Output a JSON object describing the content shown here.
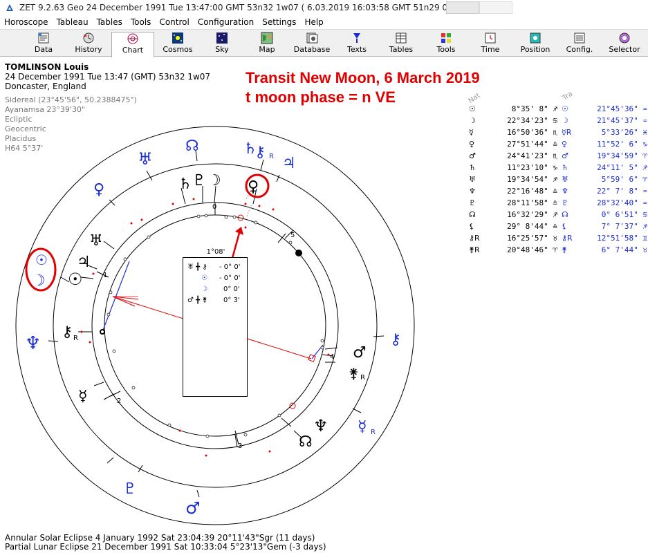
{
  "window": {
    "title": "ZET 9.2.63 Geo   24 December 1991  Tue  13:47:00 GMT 53n32  1w07   ( 6.03.2019  16:03:58 GMT 51n29 0w11)"
  },
  "menu": [
    "Horoscope",
    "Tableau",
    "Tables",
    "Tools",
    "Control",
    "Configuration",
    "Settings",
    "Help"
  ],
  "toolbar": [
    {
      "label": "Data",
      "icon": "data-icon"
    },
    {
      "label": "History",
      "icon": "history-icon"
    },
    {
      "label": "Chart",
      "icon": "chart-icon",
      "active": true
    },
    {
      "label": "Cosmos",
      "icon": "cosmos-icon"
    },
    {
      "label": "Sky",
      "icon": "sky-icon"
    },
    {
      "label": "Map",
      "icon": "map-icon"
    },
    {
      "label": "Database",
      "icon": "database-icon"
    },
    {
      "label": "Texts",
      "icon": "texts-icon"
    },
    {
      "label": "Tables",
      "icon": "tables-icon"
    },
    {
      "label": "Tools",
      "icon": "tools-icon"
    },
    {
      "label": "Time",
      "icon": "time-icon"
    },
    {
      "label": "Position",
      "icon": "position-icon"
    },
    {
      "label": "Config.",
      "icon": "config-icon"
    },
    {
      "label": "Selector",
      "icon": "selector-icon"
    }
  ],
  "person": {
    "name": "TOMLINSON Louis",
    "datetime": "24 December 1991  Tue  13:47 (GMT) 53n32  1w07",
    "place": "Doncaster, England"
  },
  "settings": [
    "Sidereal (23°45'56\", 50.2388475\")",
    "Ayanamsa 23°39'30\"",
    "Ecliptic",
    "Geocentric",
    "Placidus",
    "H64   5°37'"
  ],
  "overlay": {
    "line1": "Transit New Moon, 6 March 2019",
    "line2": "t moon phase = n VE"
  },
  "table_headers": {
    "natal": "Nat",
    "transit": "Tra"
  },
  "planets": [
    {
      "g1": "☉",
      "v1": "8°35' 8\" ♐",
      "g2": "☉",
      "v2": "21°45'36\" ♒"
    },
    {
      "g1": "☽",
      "v1": "22°34'23\" ♋",
      "g2": "☽",
      "v2": "21°45'37\" ♒"
    },
    {
      "g1": "☿",
      "v1": "16°50'36\" ♏",
      "g2": "☿R",
      "v2": "5°33'26\" ♓"
    },
    {
      "g1": "♀",
      "v1": "27°51'44\" ♎",
      "g2": "♀",
      "v2": "11°52' 6\" ♑"
    },
    {
      "g1": "♂",
      "v1": "24°41'23\" ♏",
      "g2": "♂",
      "v2": "19°34'59\" ♈"
    },
    {
      "g1": "♄",
      "v1": "11°23'10\" ♑",
      "g2": "♄",
      "v2": "24°11' 5\" ♐"
    },
    {
      "g1": "♅",
      "v1": "19°34'54\" ♐",
      "g2": "♅",
      "v2": "5°59' 6\" ♈"
    },
    {
      "g1": "♆",
      "v1": "22°16'48\" ♎",
      "g2": "♆",
      "v2": "22° 7' 8\" ♒"
    },
    {
      "g1": "♇",
      "v1": "28°11'58\" ♎",
      "g2": "♇",
      "v2": "28°32'40\" ♒"
    },
    {
      "g1": "☊",
      "v1": "16°32'29\" ♐",
      "g2": "☊",
      "v2": "0° 6'51\" ♋"
    },
    {
      "g1": "⚸",
      "v1": "29° 8'44\" ♎",
      "g2": "⚸",
      "v2": "7° 7'37\" ♐"
    },
    {
      "g1": "⚷R",
      "v1": "16°25'57\" ♉",
      "g2": "⚷R",
      "v2": "12°51'58\" ♊"
    },
    {
      "g1": "⚵R",
      "v1": "20°48'46\" ♈",
      "g2": "⚵",
      "v2": "6° 7'44\" ♉"
    }
  ],
  "aspect_box": {
    "header": "1°08'",
    "rows": [
      {
        "glyphs": "♅ ╋ ⚷",
        "value": "- 0° 0'"
      },
      {
        "glyphs": "☉",
        "value": "- 0° 0'"
      },
      {
        "glyphs": "☽",
        "value": "0° 0'"
      },
      {
        "glyphs": "♂ ╋ ⚵",
        "value": "0° 3'"
      }
    ]
  },
  "house_numbers": [
    "0",
    "1",
    "2",
    "3",
    "4",
    "5"
  ],
  "outer_glyphs": [
    "♅",
    "♀",
    "☊",
    "♄",
    "⚷",
    "♃",
    "♆",
    "⚷",
    "☿",
    "♆",
    "♂",
    "⚵",
    "♂",
    "♇"
  ],
  "inner_glyphs": [
    "♄",
    "♇",
    "☽",
    "♀",
    "♅",
    "♃",
    "☉",
    "⚷",
    "☿",
    "☽",
    "♆",
    "☊",
    "♂",
    "⚵",
    "☉"
  ],
  "eclipses": [
    "Annular Solar Eclipse 4 January 1992 Sat 23:04:39 20°11'43\"Sgr (11 days)",
    "Partial Lunar Eclipse 21 December 1991 Sat 10:33:04  5°23'13\"Gem (-3 days)"
  ],
  "colors": {
    "accent": "#e00000",
    "transit": "#1a2bd6",
    "toolbar": "#f0f0f0"
  }
}
